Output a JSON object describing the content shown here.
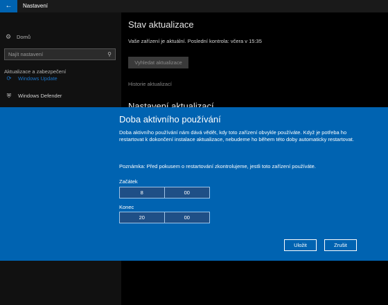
{
  "window": {
    "title": "Nastavení",
    "back_icon": "back-arrow-icon"
  },
  "sidebar": {
    "home": {
      "label": "Domů",
      "icon": "gear-icon"
    },
    "search": {
      "placeholder": "Najít nastavení",
      "icon": "search-icon"
    },
    "section_label": "Aktualizace a zabezpečení",
    "items": [
      {
        "label": "Windows Update",
        "icon": "refresh-icon",
        "active": true
      },
      {
        "label": "Windows Defender",
        "icon": "shield-icon",
        "active": false
      }
    ]
  },
  "main": {
    "title": "Stav aktualizace",
    "status": "Vaše zařízení je aktuální. Poslední kontrola: včera v 15:35",
    "check_button": "Vyhledat aktualizace",
    "history_link": "Historie aktualizací",
    "settings_heading": "Nastavení aktualizací"
  },
  "dialog": {
    "title": "Doba aktivního používání",
    "description": "Doba aktivního používání nám dává vědět, kdy toto zařízení obvykle používáte. Když je potřeba ho restartovat k dokončení instalace aktualizace, nebudeme ho během této doby automaticky restartovat.",
    "note": "Poznámka: Před pokusem o restartování zkontrolujeme, jestli toto zařízení používáte.",
    "start": {
      "label": "Začátek",
      "hour": "8",
      "minute": "00"
    },
    "end": {
      "label": "Konec",
      "hour": "20",
      "minute": "00"
    },
    "save_button": "Uložit",
    "cancel_button": "Zrušit"
  },
  "colors": {
    "accent": "#0063b1",
    "active_nav": "#1a73c8",
    "background": "#000000"
  }
}
